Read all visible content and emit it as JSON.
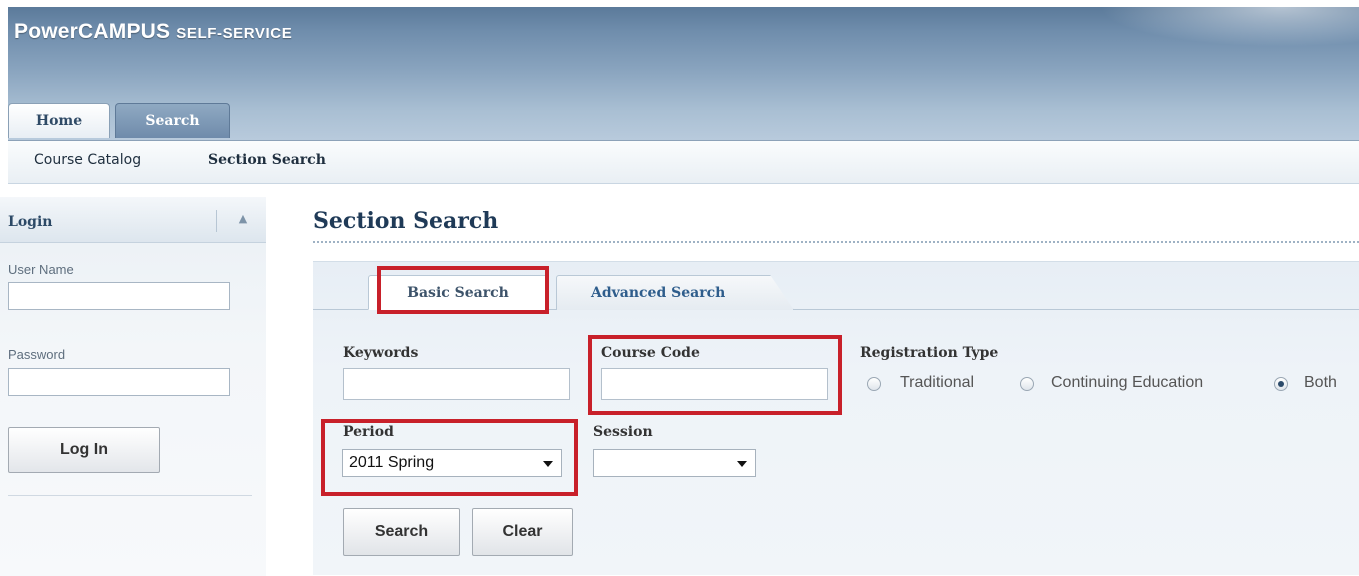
{
  "brand": {
    "name": "PowerCAMPUS",
    "suffix": "SELF-SERVICE"
  },
  "main_tabs": [
    {
      "label": "Home",
      "active": false
    },
    {
      "label": "Search",
      "active": true
    }
  ],
  "subnav": {
    "course_catalog": "Course Catalog",
    "section_search": "Section Search"
  },
  "login": {
    "title": "Login",
    "user_name_label": "User Name",
    "user_name_value": "",
    "password_label": "Password",
    "password_value": "",
    "button": "Log In"
  },
  "page_title": "Section Search",
  "search_tabs": {
    "basic": "Basic Search",
    "advanced": "Advanced Search"
  },
  "form": {
    "keywords_label": "Keywords",
    "keywords_value": "",
    "course_code_label": "Course Code",
    "course_code_value": "",
    "registration_type_label": "Registration Type",
    "registration_options": [
      "Traditional",
      "Continuing Education",
      "Both"
    ],
    "registration_selected": "Both",
    "period_label": "Period",
    "period_value": "2011 Spring",
    "session_label": "Session",
    "session_value": "",
    "search_button": "Search",
    "clear_button": "Clear"
  },
  "colors": {
    "highlight": "#c8202a",
    "title": "#1f3a57",
    "banner": "#6f8dac"
  }
}
